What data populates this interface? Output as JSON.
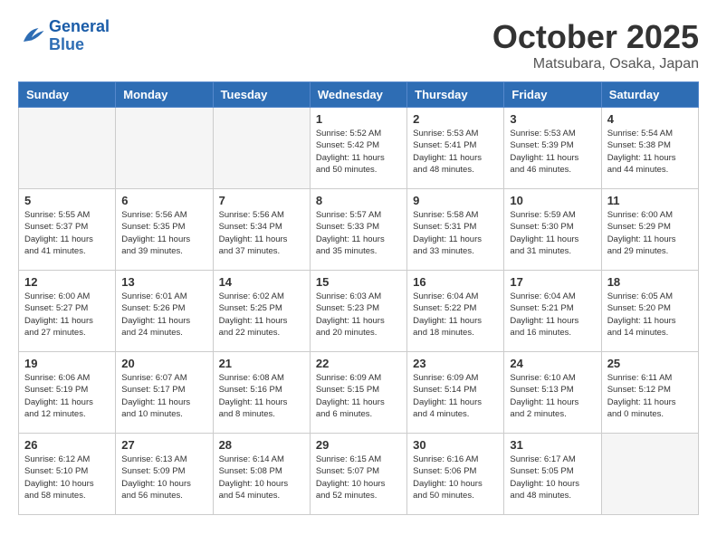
{
  "logo": {
    "line1": "General",
    "line2": "Blue"
  },
  "title": "October 2025",
  "subtitle": "Matsubara, Osaka, Japan",
  "days_header": [
    "Sunday",
    "Monday",
    "Tuesday",
    "Wednesday",
    "Thursday",
    "Friday",
    "Saturday"
  ],
  "weeks": [
    [
      {
        "day": "",
        "detail": ""
      },
      {
        "day": "",
        "detail": ""
      },
      {
        "day": "",
        "detail": ""
      },
      {
        "day": "1",
        "detail": "Sunrise: 5:52 AM\nSunset: 5:42 PM\nDaylight: 11 hours\nand 50 minutes."
      },
      {
        "day": "2",
        "detail": "Sunrise: 5:53 AM\nSunset: 5:41 PM\nDaylight: 11 hours\nand 48 minutes."
      },
      {
        "day": "3",
        "detail": "Sunrise: 5:53 AM\nSunset: 5:39 PM\nDaylight: 11 hours\nand 46 minutes."
      },
      {
        "day": "4",
        "detail": "Sunrise: 5:54 AM\nSunset: 5:38 PM\nDaylight: 11 hours\nand 44 minutes."
      }
    ],
    [
      {
        "day": "5",
        "detail": "Sunrise: 5:55 AM\nSunset: 5:37 PM\nDaylight: 11 hours\nand 41 minutes."
      },
      {
        "day": "6",
        "detail": "Sunrise: 5:56 AM\nSunset: 5:35 PM\nDaylight: 11 hours\nand 39 minutes."
      },
      {
        "day": "7",
        "detail": "Sunrise: 5:56 AM\nSunset: 5:34 PM\nDaylight: 11 hours\nand 37 minutes."
      },
      {
        "day": "8",
        "detail": "Sunrise: 5:57 AM\nSunset: 5:33 PM\nDaylight: 11 hours\nand 35 minutes."
      },
      {
        "day": "9",
        "detail": "Sunrise: 5:58 AM\nSunset: 5:31 PM\nDaylight: 11 hours\nand 33 minutes."
      },
      {
        "day": "10",
        "detail": "Sunrise: 5:59 AM\nSunset: 5:30 PM\nDaylight: 11 hours\nand 31 minutes."
      },
      {
        "day": "11",
        "detail": "Sunrise: 6:00 AM\nSunset: 5:29 PM\nDaylight: 11 hours\nand 29 minutes."
      }
    ],
    [
      {
        "day": "12",
        "detail": "Sunrise: 6:00 AM\nSunset: 5:27 PM\nDaylight: 11 hours\nand 27 minutes."
      },
      {
        "day": "13",
        "detail": "Sunrise: 6:01 AM\nSunset: 5:26 PM\nDaylight: 11 hours\nand 24 minutes."
      },
      {
        "day": "14",
        "detail": "Sunrise: 6:02 AM\nSunset: 5:25 PM\nDaylight: 11 hours\nand 22 minutes."
      },
      {
        "day": "15",
        "detail": "Sunrise: 6:03 AM\nSunset: 5:23 PM\nDaylight: 11 hours\nand 20 minutes."
      },
      {
        "day": "16",
        "detail": "Sunrise: 6:04 AM\nSunset: 5:22 PM\nDaylight: 11 hours\nand 18 minutes."
      },
      {
        "day": "17",
        "detail": "Sunrise: 6:04 AM\nSunset: 5:21 PM\nDaylight: 11 hours\nand 16 minutes."
      },
      {
        "day": "18",
        "detail": "Sunrise: 6:05 AM\nSunset: 5:20 PM\nDaylight: 11 hours\nand 14 minutes."
      }
    ],
    [
      {
        "day": "19",
        "detail": "Sunrise: 6:06 AM\nSunset: 5:19 PM\nDaylight: 11 hours\nand 12 minutes."
      },
      {
        "day": "20",
        "detail": "Sunrise: 6:07 AM\nSunset: 5:17 PM\nDaylight: 11 hours\nand 10 minutes."
      },
      {
        "day": "21",
        "detail": "Sunrise: 6:08 AM\nSunset: 5:16 PM\nDaylight: 11 hours\nand 8 minutes."
      },
      {
        "day": "22",
        "detail": "Sunrise: 6:09 AM\nSunset: 5:15 PM\nDaylight: 11 hours\nand 6 minutes."
      },
      {
        "day": "23",
        "detail": "Sunrise: 6:09 AM\nSunset: 5:14 PM\nDaylight: 11 hours\nand 4 minutes."
      },
      {
        "day": "24",
        "detail": "Sunrise: 6:10 AM\nSunset: 5:13 PM\nDaylight: 11 hours\nand 2 minutes."
      },
      {
        "day": "25",
        "detail": "Sunrise: 6:11 AM\nSunset: 5:12 PM\nDaylight: 11 hours\nand 0 minutes."
      }
    ],
    [
      {
        "day": "26",
        "detail": "Sunrise: 6:12 AM\nSunset: 5:10 PM\nDaylight: 10 hours\nand 58 minutes."
      },
      {
        "day": "27",
        "detail": "Sunrise: 6:13 AM\nSunset: 5:09 PM\nDaylight: 10 hours\nand 56 minutes."
      },
      {
        "day": "28",
        "detail": "Sunrise: 6:14 AM\nSunset: 5:08 PM\nDaylight: 10 hours\nand 54 minutes."
      },
      {
        "day": "29",
        "detail": "Sunrise: 6:15 AM\nSunset: 5:07 PM\nDaylight: 10 hours\nand 52 minutes."
      },
      {
        "day": "30",
        "detail": "Sunrise: 6:16 AM\nSunset: 5:06 PM\nDaylight: 10 hours\nand 50 minutes."
      },
      {
        "day": "31",
        "detail": "Sunrise: 6:17 AM\nSunset: 5:05 PM\nDaylight: 10 hours\nand 48 minutes."
      },
      {
        "day": "",
        "detail": ""
      }
    ]
  ]
}
